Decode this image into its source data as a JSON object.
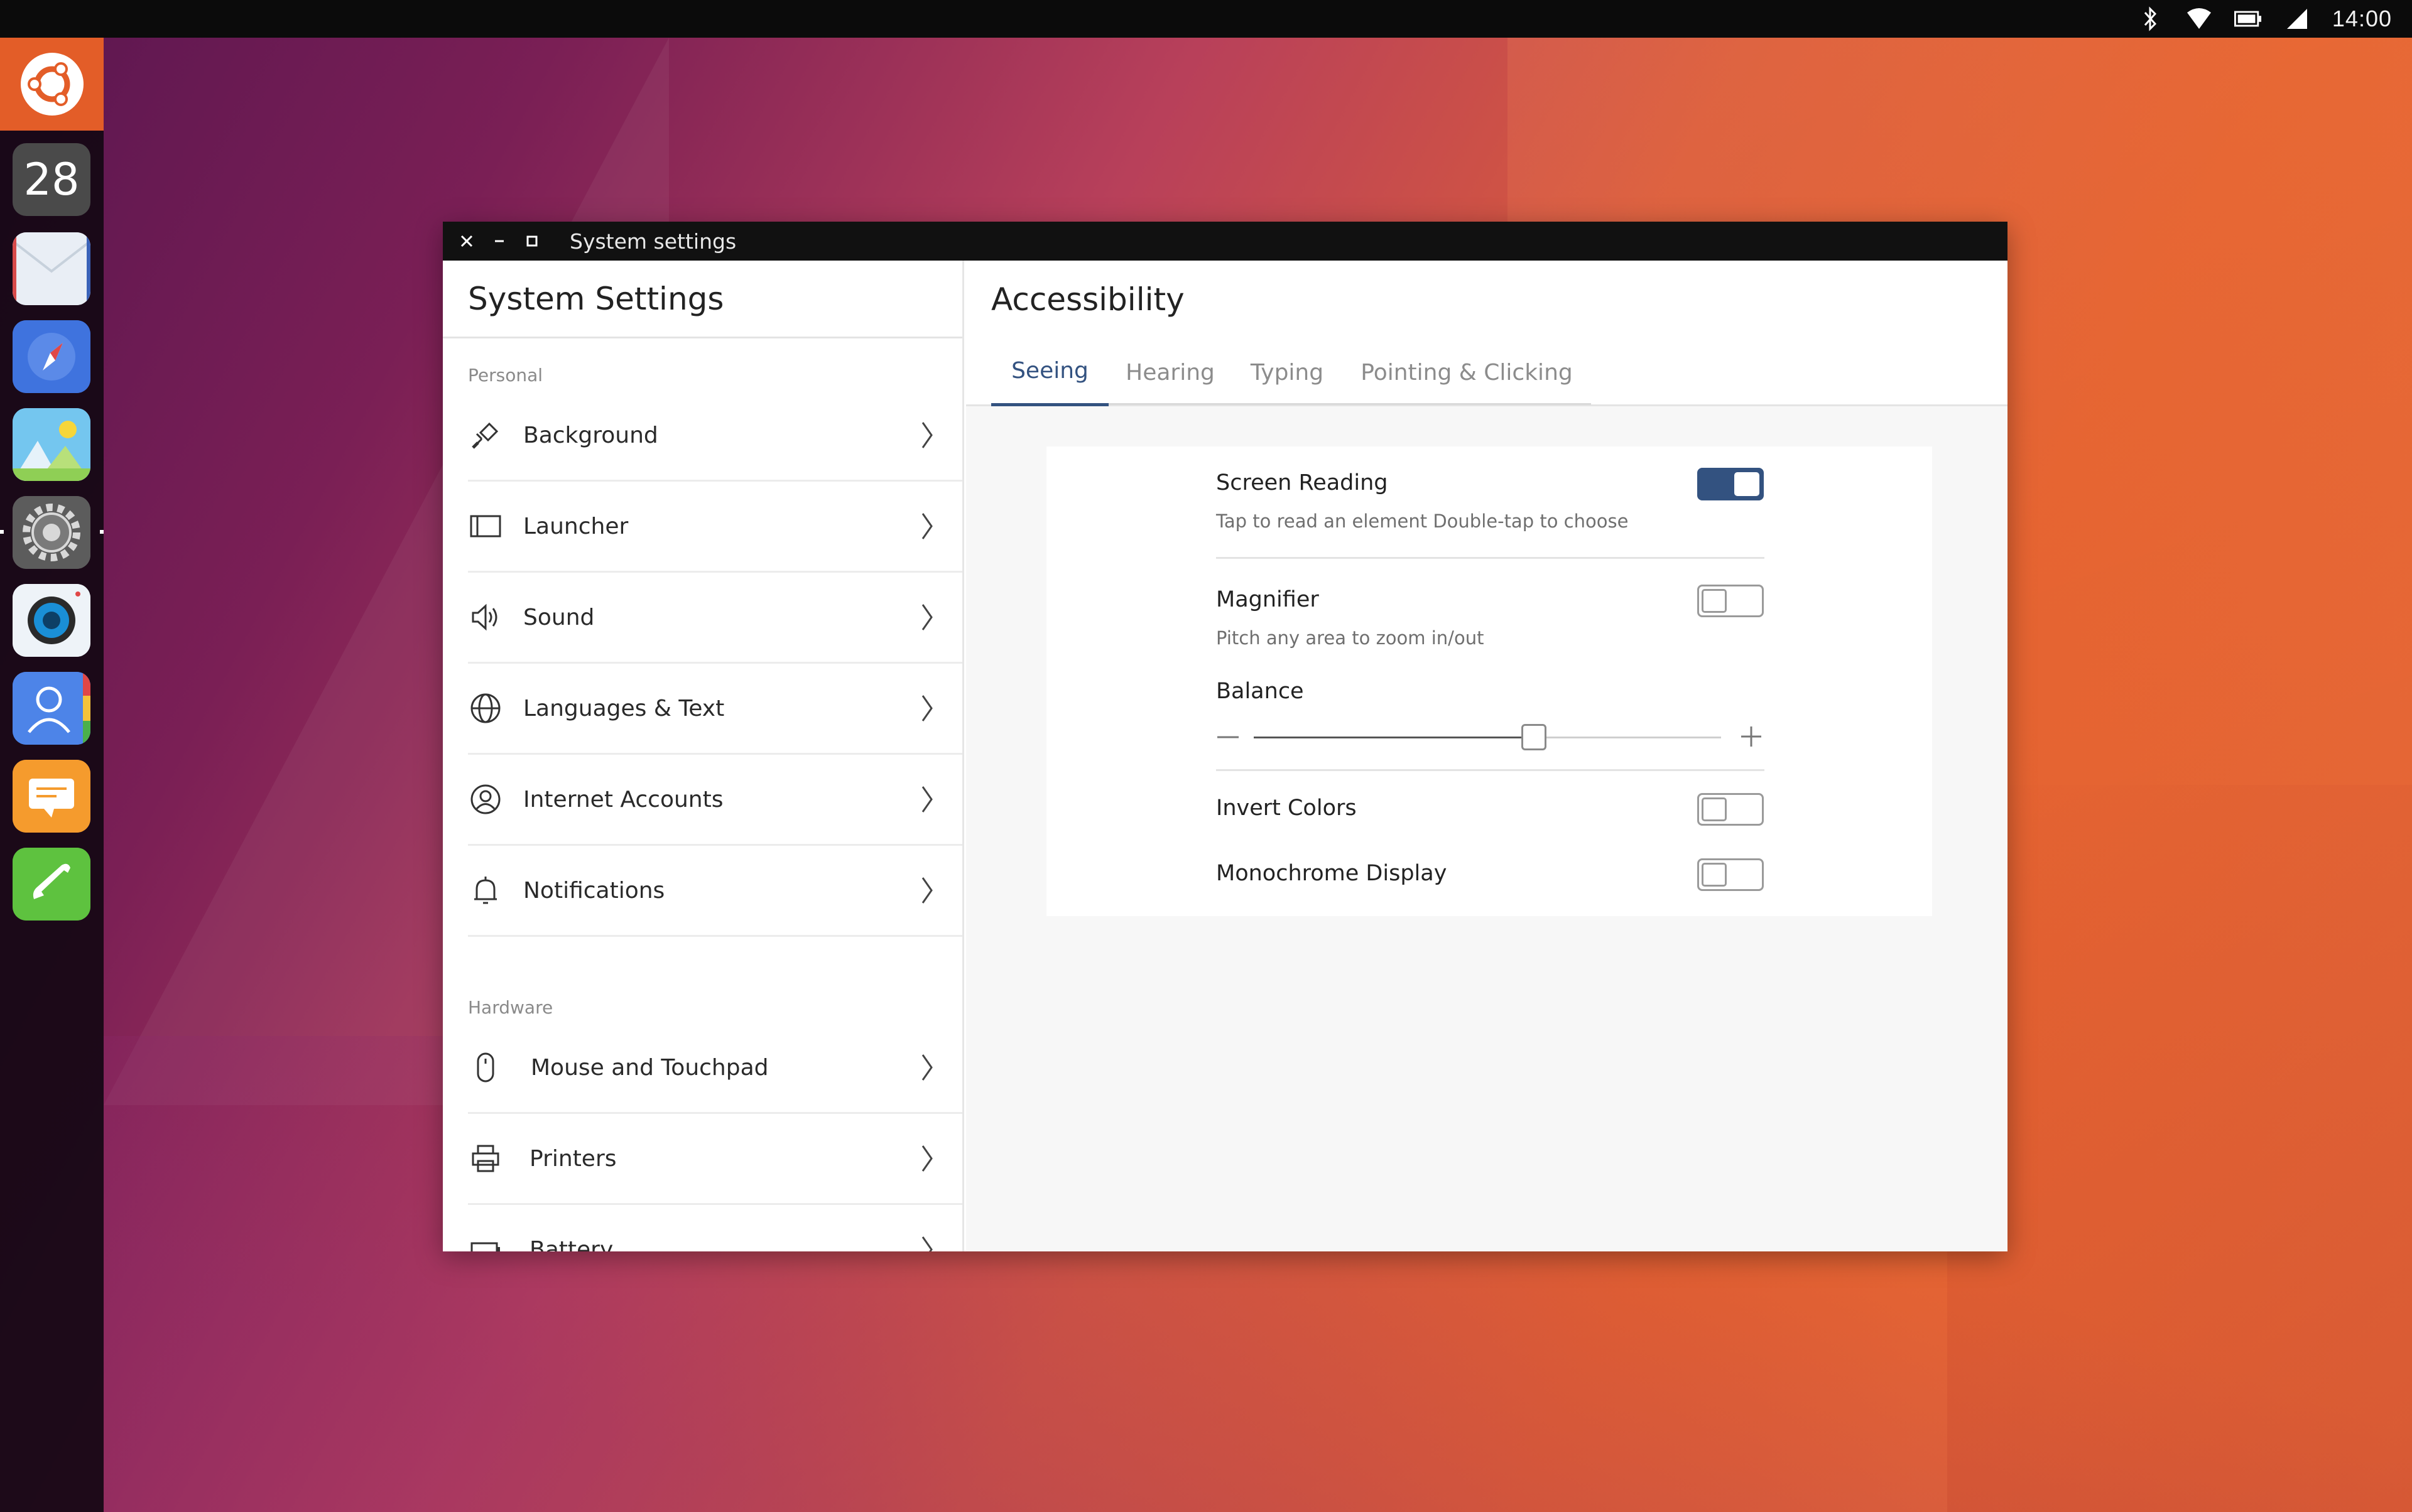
{
  "topbar": {
    "clock": "14:00",
    "indicators": [
      "bluetooth-icon",
      "wifi-icon",
      "battery-icon",
      "signal-icon"
    ]
  },
  "launcher": {
    "apps": [
      {
        "name": "calendar",
        "label": "28"
      },
      {
        "name": "mail"
      },
      {
        "name": "browser"
      },
      {
        "name": "gallery"
      },
      {
        "name": "system-settings"
      },
      {
        "name": "camera"
      },
      {
        "name": "contacts"
      },
      {
        "name": "messaging"
      },
      {
        "name": "phone"
      }
    ]
  },
  "window": {
    "title": "System settings"
  },
  "left": {
    "title": "System Settings",
    "sections": [
      {
        "label": "Personal",
        "items": [
          {
            "label": "Background",
            "icon": "brush-icon"
          },
          {
            "label": "Launcher",
            "icon": "launcher-icon"
          },
          {
            "label": "Sound",
            "icon": "speaker-icon"
          },
          {
            "label": "Languages & Text",
            "icon": "globe-icon"
          },
          {
            "label": "Internet Accounts",
            "icon": "account-icon"
          },
          {
            "label": "Notifications",
            "icon": "bell-icon"
          }
        ]
      },
      {
        "label": "Hardware",
        "items": [
          {
            "label": "Mouse and Touchpad",
            "icon": "mouse-icon"
          },
          {
            "label": "Printers",
            "icon": "printer-icon"
          },
          {
            "label": "Battery",
            "icon": "battery-icon"
          }
        ]
      }
    ]
  },
  "right": {
    "title": "Accessibility",
    "tabs": [
      {
        "label": "Seeing",
        "active": true
      },
      {
        "label": "Hearing",
        "active": false
      },
      {
        "label": "Typing",
        "active": false
      },
      {
        "label": "Pointing & Clicking",
        "active": false
      }
    ],
    "screen_reading": {
      "label": "Screen Reading",
      "desc": "Tap to read an element Double-tap to choose",
      "enabled": true
    },
    "magnifier": {
      "label": "Magnifier",
      "desc": "Pitch any area to zoom in/out",
      "enabled": false
    },
    "balance": {
      "label": "Balance",
      "value": 0.6
    },
    "invert_colors": {
      "label": "Invert Colors",
      "enabled": false
    },
    "monochrome": {
      "label": "Monochrome Display",
      "enabled": false
    }
  },
  "colors": {
    "accent": "#335280",
    "launcher_home": "#e35d28",
    "titlebar": "#111111"
  }
}
